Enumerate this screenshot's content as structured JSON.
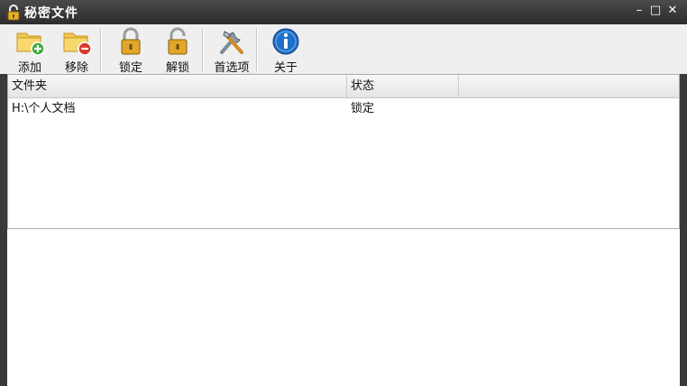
{
  "window": {
    "title": "秘密文件",
    "controls": {
      "minimize": "–",
      "maximize": "□",
      "close": "✕"
    }
  },
  "toolbar": {
    "add": "添加",
    "remove": "移除",
    "lock": "锁定",
    "unlock": "解锁",
    "preferences": "首选项",
    "about": "关于"
  },
  "table": {
    "columns": [
      "文件夹",
      "状态"
    ],
    "rows": [
      {
        "folder": "H:\\个人文档",
        "status": "锁定"
      }
    ]
  },
  "colors": {
    "titlebar": "#3a3a3a",
    "toolbar": "#efefef",
    "lock_gold": "#e0a72a",
    "about_blue": "#1f6fc7"
  }
}
